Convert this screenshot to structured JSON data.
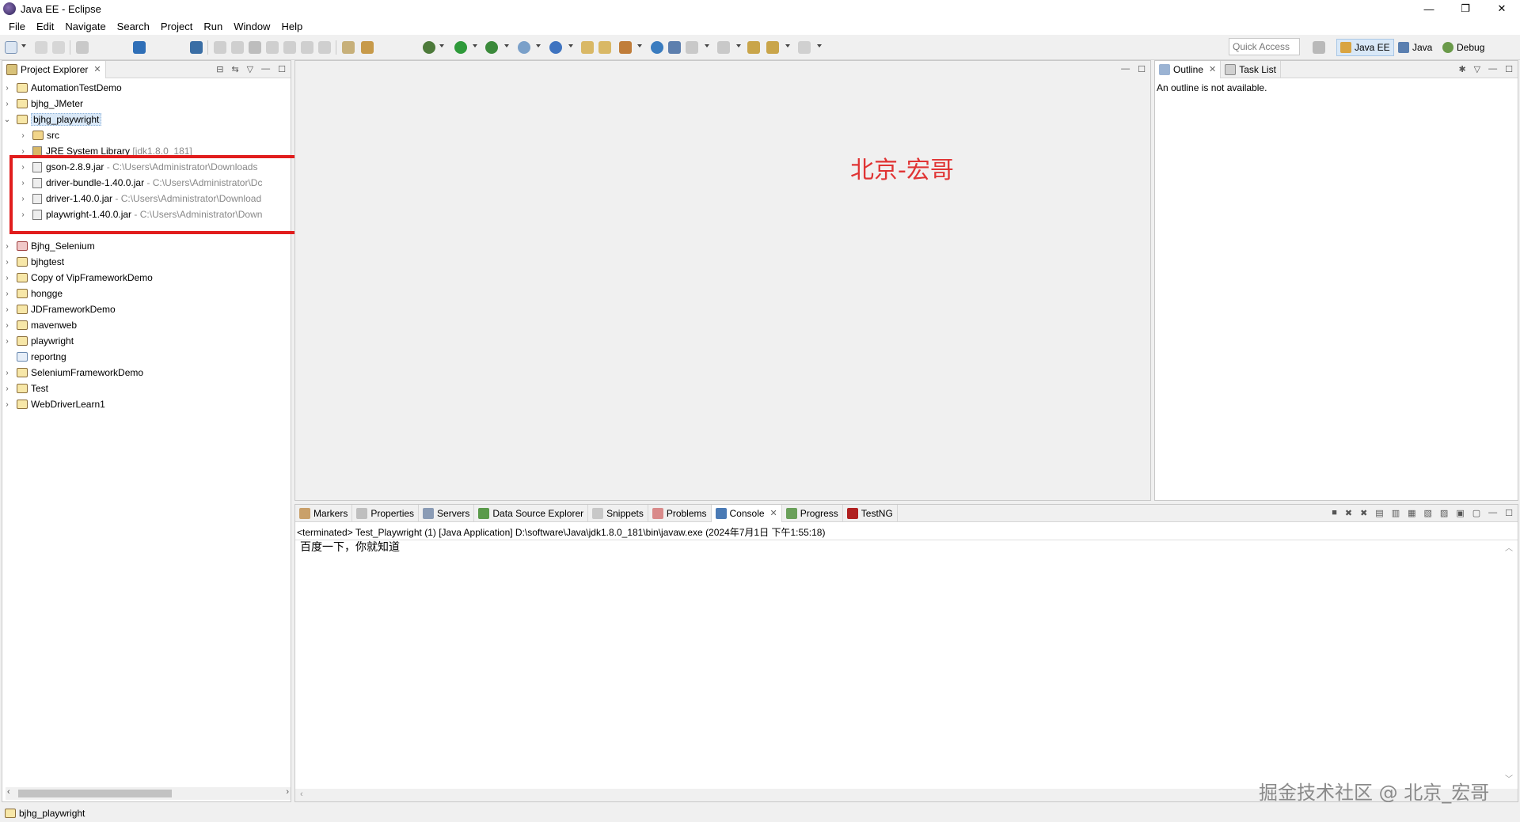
{
  "window": {
    "title": "Java EE - Eclipse"
  },
  "window_controls": {
    "minimize": "—",
    "restore": "❐",
    "close": "✕"
  },
  "menu": [
    "File",
    "Edit",
    "Navigate",
    "Search",
    "Project",
    "Run",
    "Window",
    "Help"
  ],
  "toolbar": {
    "quick_access_placeholder": "Quick Access",
    "perspectives": [
      {
        "label": "Java EE",
        "icon": "java-ee-perspective-icon"
      },
      {
        "label": "Java",
        "icon": "java-perspective-icon"
      },
      {
        "label": "Debug",
        "icon": "debug-perspective-icon"
      }
    ]
  },
  "project_explorer": {
    "tab_label": "Project Explorer",
    "tree": [
      {
        "label": "AutomationTestDemo",
        "chev": "›"
      },
      {
        "label": "bjhg_JMeter",
        "chev": "›"
      },
      {
        "label": "bjhg_playwright",
        "chev": "⌄"
      },
      {
        "label": "src",
        "chev": "›"
      },
      {
        "label": "JRE System Library",
        "detail": "[jdk1.8.0_181]",
        "chev": "›"
      },
      {
        "label": "gson-2.8.9.jar",
        "detail": "- C:\\Users\\Administrator\\Downloads",
        "chev": "›"
      },
      {
        "label": "driver-bundle-1.40.0.jar",
        "detail": "- C:\\Users\\Administrator\\Dc",
        "chev": "›"
      },
      {
        "label": "driver-1.40.0.jar",
        "detail": "- C:\\Users\\Administrator\\Download",
        "chev": "›"
      },
      {
        "label": "playwright-1.40.0.jar",
        "detail": "- C:\\Users\\Administrator\\Down",
        "chev": "›"
      },
      {
        "label": "Bjhg_Selenium",
        "chev": "›"
      },
      {
        "label": "bjhgtest",
        "chev": "›"
      },
      {
        "label": "Copy of VipFrameworkDemo",
        "chev": "›"
      },
      {
        "label": "hongge",
        "chev": "›"
      },
      {
        "label": "JDFrameworkDemo",
        "chev": "›"
      },
      {
        "label": "mavenweb",
        "chev": "›"
      },
      {
        "label": "playwright",
        "chev": "›"
      },
      {
        "label": "reportng",
        "chev": ""
      },
      {
        "label": "SeleniumFrameworkDemo",
        "chev": "›"
      },
      {
        "label": "Test",
        "chev": "›"
      },
      {
        "label": "WebDriverLearn1",
        "chev": "›"
      }
    ]
  },
  "editor": {
    "overlay_text": "北京-宏哥"
  },
  "outline": {
    "tabs": [
      "Outline",
      "Task List"
    ],
    "message": "An outline is not available."
  },
  "console_panel": {
    "tabs": [
      "Markers",
      "Properties",
      "Servers",
      "Data Source Explorer",
      "Snippets",
      "Problems",
      "Console",
      "Progress",
      "TestNG"
    ],
    "active_tab": "Console",
    "header": "<terminated> Test_Playwright (1) [Java Application] D:\\software\\Java\\jdk1.8.0_181\\bin\\javaw.exe (2024年7月1日 下午1:55:18)",
    "output": "百度一下，你就知道"
  },
  "status_bar": {
    "text": "bjhg_playwright"
  },
  "watermark": "掘金技术社区 @ 北京_宏哥"
}
